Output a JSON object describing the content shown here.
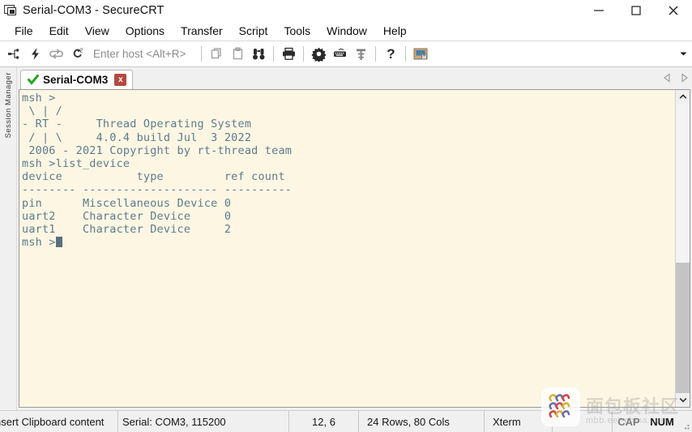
{
  "window": {
    "title": "Serial-COM3 - SecureCRT",
    "icon": "securecrt-app-icon",
    "controls": [
      {
        "name": "minimize",
        "glyph": "minimize-icon"
      },
      {
        "name": "maximize",
        "glyph": "maximize-icon"
      },
      {
        "name": "close",
        "glyph": "close-icon"
      }
    ]
  },
  "menubar": {
    "items": [
      {
        "label": "File"
      },
      {
        "label": "Edit"
      },
      {
        "label": "View"
      },
      {
        "label": "Options"
      },
      {
        "label": "Transfer"
      },
      {
        "label": "Script"
      },
      {
        "label": "Tools"
      },
      {
        "label": "Window"
      },
      {
        "label": "Help"
      }
    ]
  },
  "toolbar": {
    "host_placeholder": "Enter host <Alt+R>",
    "buttons": [
      {
        "name": "connect-icon",
        "tip": "Connect"
      },
      {
        "name": "quick-connect-icon",
        "tip": "Quick Connect"
      },
      {
        "name": "connect-in-tab-icon",
        "tip": "Connect in Tab"
      },
      {
        "name": "reconnect-icon",
        "tip": "Reconnect"
      },
      {
        "name": "copy-icon",
        "tip": "Copy"
      },
      {
        "name": "paste-icon",
        "tip": "Paste"
      },
      {
        "name": "find-icon",
        "tip": "Find"
      },
      {
        "name": "print-icon",
        "tip": "Print"
      },
      {
        "name": "session-options-icon",
        "tip": "Session Options"
      },
      {
        "name": "keymap-icon",
        "tip": "Keymap Editor"
      },
      {
        "name": "key-icon",
        "tip": "Public Key"
      },
      {
        "name": "help-icon",
        "tip": "Help"
      },
      {
        "name": "session-manager-icon",
        "tip": "Session Manager"
      }
    ],
    "overflow": "chevron-down-icon"
  },
  "sidebar": {
    "label": "Session Manager"
  },
  "tabs": {
    "items": [
      {
        "label": "Serial-COM3",
        "status_icon": "green-check-icon",
        "close_label": "x",
        "active": true
      }
    ],
    "nav_prev": "triangle-left-icon",
    "nav_next": "triangle-right-icon"
  },
  "terminal": {
    "background": "#fdf6e3",
    "foreground": "#5b7c8d",
    "cursor_color": "#58707d",
    "lines": [
      "msh >",
      " \\ | /",
      "- RT -     Thread Operating System",
      " / | \\     4.0.4 build Jul  3 2022",
      " 2006 - 2021 Copyright by rt-thread team",
      "msh >list_device",
      "device           type         ref count",
      "-------- -------------------- ----------",
      "pin      Miscellaneous Device 0",
      "uart2    Character Device     0",
      "uart1    Character Device     2"
    ],
    "prompt": "msh >",
    "scrollbar": {
      "up_arrow": "chevron-up-icon",
      "down_arrow": "chevron-down-icon"
    }
  },
  "statusbar": {
    "hint": "nsert Clipboard content",
    "serial": "Serial: COM3, 115200",
    "position": "12,  6",
    "dimensions": "24 Rows, 80 Cols",
    "emulation": "Xterm",
    "cap_label": "CAP",
    "num_label": "NUM"
  },
  "watermark": {
    "cn_text": "面包板社区",
    "en_text": "mbb.eet-china.com",
    "logo": "mbb-logo-icon"
  }
}
